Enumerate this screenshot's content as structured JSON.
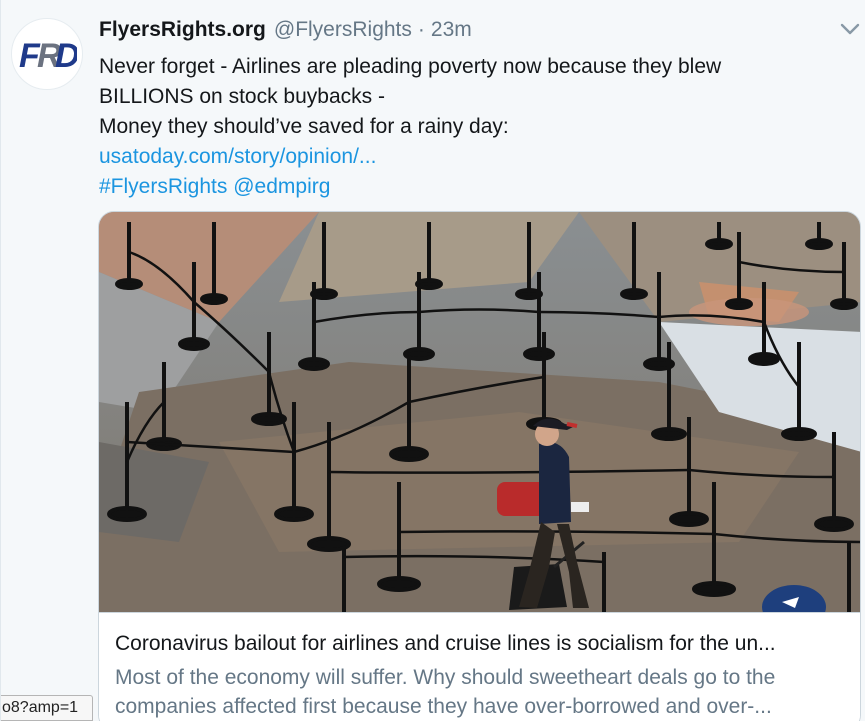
{
  "tweet": {
    "display_name": "FlyersRights.org",
    "handle": "@FlyersRights",
    "separator": "·",
    "time": "23m",
    "text_lines": [
      "Never forget - Airlines are pleading poverty now because they blew",
      "BILLIONS on stock buybacks -",
      "Money they should’ve saved for a rainy day:"
    ],
    "link": "usatoday.com/story/opinion/...",
    "hashtag": "#FlyersRights",
    "mention": "@edmpirg",
    "avatar_logo_text": "FRD",
    "avatar_colors": {
      "F": "#1f3a8a",
      "R": "#6b7280",
      "D": "#1f3a8a"
    },
    "menu_icon": "chevron-down-icon"
  },
  "card": {
    "image_alt": "Traveler with red backpack walking through empty airport security stanchion lines",
    "title": "Coronavirus bailout for airlines and cruise lines is socialism for the un...",
    "description_lines": [
      "Most of the economy will suffer. Why should sweetheart deals go to the",
      "companies affected first because they have over-borrowed and over-..."
    ]
  },
  "status_bar": {
    "url_fragment": "o8?amp=1"
  },
  "colors": {
    "link": "#1b95e0",
    "secondary_text": "#657786",
    "primary_text": "#14171a",
    "background": "#f5f8fa",
    "card_border": "#ccd6dd"
  }
}
